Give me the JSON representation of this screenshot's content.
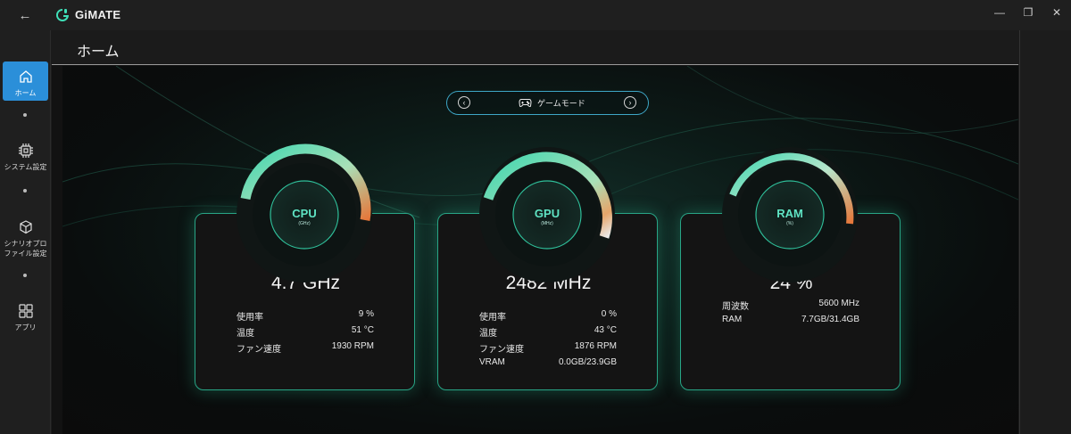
{
  "app": {
    "title": "GiMATE"
  },
  "window_controls": {
    "minimize": "—",
    "restore": "❐",
    "close": "✕"
  },
  "sidebar": {
    "items": [
      {
        "label": "ホーム",
        "icon": "home-icon",
        "active": true
      },
      {
        "label": "システム設定",
        "icon": "chip-icon",
        "active": false
      },
      {
        "label": "シナリオプロファイル設定",
        "label_lines": [
          "シナリオプロ",
          "ファイル設定"
        ],
        "icon": "cube-icon",
        "active": false
      },
      {
        "label": "アプリ",
        "icon": "apps-grid-icon",
        "active": false
      }
    ]
  },
  "page": {
    "title": "ホーム"
  },
  "mode_selector": {
    "label": "ゲームモード",
    "icon": "gamepad-icon"
  },
  "cards": [
    {
      "gauge_title": "CPU",
      "gauge_unit": "(GHz)",
      "value": "4.7 GHz",
      "rows": [
        {
          "label": "使用率",
          "value": "9 %"
        },
        {
          "label": "温度",
          "value": "51 °C"
        },
        {
          "label": "ファン速度",
          "value": "1930 RPM"
        }
      ]
    },
    {
      "gauge_title": "GPU",
      "gauge_unit": "(MHz)",
      "value": "2482 MHz",
      "rows": [
        {
          "label": "使用率",
          "value": "0 %"
        },
        {
          "label": "温度",
          "value": "43 °C"
        },
        {
          "label": "ファン速度",
          "value": "1876 RPM"
        },
        {
          "label": "VRAM",
          "value": "0.0GB/23.9GB"
        }
      ]
    },
    {
      "gauge_title": "RAM",
      "gauge_unit": "(%)",
      "value": "24 %",
      "rows": [
        {
          "label": "周波数",
          "value": "5600 MHz"
        },
        {
          "label": "RAM",
          "value": "7.7GB/31.4GB"
        }
      ]
    }
  ],
  "colors": {
    "accent": "#2b8fd9",
    "teal": "#28a586",
    "gauge_start": "#3fd6b0",
    "gauge_end": "#e6773a"
  }
}
